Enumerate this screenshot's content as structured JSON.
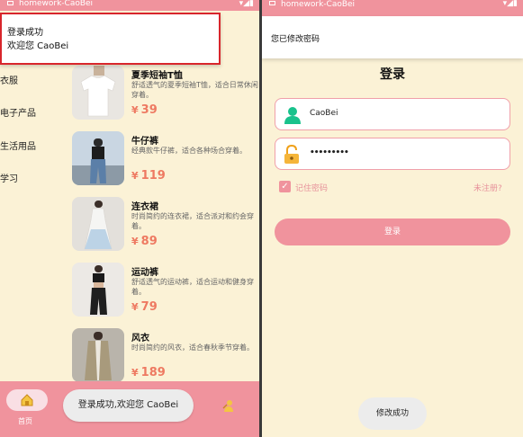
{
  "left": {
    "status_title": "homework-CaoBei",
    "notification": {
      "title": "登录成功",
      "body": "欢迎您 CaoBei"
    },
    "categories": [
      "衣服",
      "电子产品",
      "生活用品",
      "学习"
    ],
    "products": [
      {
        "name": "夏季短袖T恤",
        "desc": "舒适透气的夏季短袖T恤，适合日常休闲穿着。",
        "price": "39",
        "currency": "¥",
        "image": "white-tshirt"
      },
      {
        "name": "牛仔裤",
        "desc": "经典款牛仔裤，适合各种场合穿着。",
        "price": "119",
        "currency": "¥",
        "image": "jeans"
      },
      {
        "name": "连衣裙",
        "desc": "时尚简约的连衣裙，适合派对和约会穿着。",
        "price": "89",
        "currency": "¥",
        "image": "dress"
      },
      {
        "name": "运动裤",
        "desc": "舒适透气的运动裤，适合运动和健身穿着。",
        "price": "79",
        "currency": "¥",
        "image": "sportswear"
      },
      {
        "name": "风衣",
        "desc": "时尚简约的风衣，适合春秋季节穿着。",
        "price": "189",
        "currency": "¥",
        "image": "trench-coat"
      }
    ],
    "tabbar": {
      "home_label": "首页",
      "toast": "登录成功,欢迎您 CaoBei"
    }
  },
  "right": {
    "status_title": "homework-CaoBei",
    "notification": "您已修改密码",
    "title": "登录",
    "username_value": "CaoBei",
    "password_value": "•••••••••",
    "remember_label": "记住密码",
    "register_link": "未注册?",
    "login_button": "登录",
    "toast": "修改成功"
  },
  "colors": {
    "accent": "#f0939d",
    "background": "#fbf2d6",
    "price": "#ee7a62",
    "alert_border": "#d8262c"
  }
}
